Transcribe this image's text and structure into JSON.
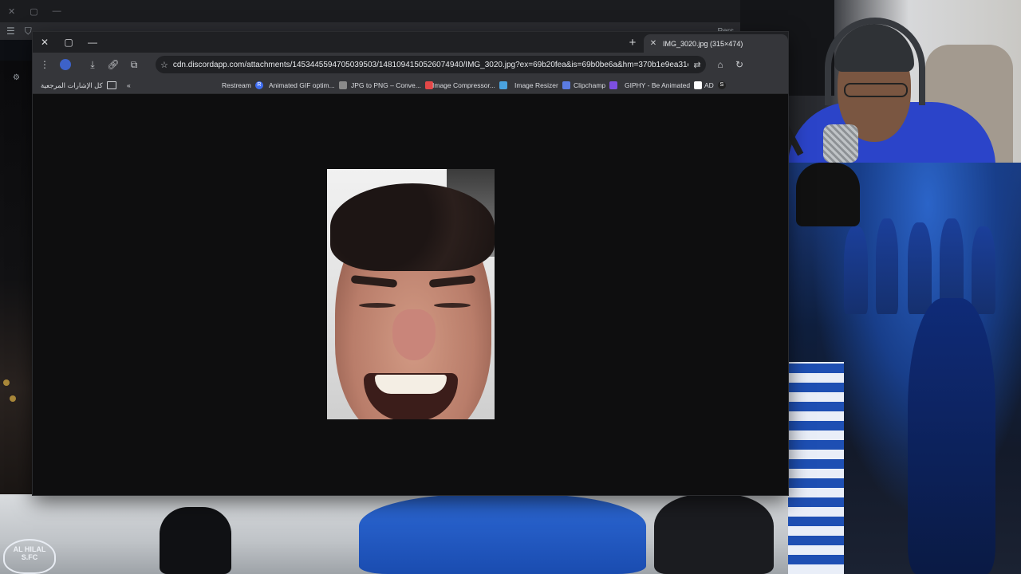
{
  "background": {
    "top_bar_title": "Pers",
    "club_badge_text": "AL HILAL S.FC"
  },
  "browser": {
    "tab": {
      "title": "IMG_3020.jpg (315×474)"
    },
    "omnibox": {
      "url": "cdn.discordapp.com/attachments/1453445594705039503/1481094150526074940/IMG_3020.jpg?ex=69b20fea&is=69b0be6a&hm=370b1e9ea31c7717e..."
    },
    "bookmarks": {
      "all_bookmarks_label": "كل الإشارات المرجعية",
      "items": [
        {
          "label": "Restream",
          "favicon_color": "#3f6ef2",
          "favicon_text": "R"
        },
        {
          "label": "Animated GIF optim...",
          "favicon_color": "#8a8a8a",
          "favicon_text": ""
        },
        {
          "label": "JPG to PNG – Conve...",
          "favicon_color": "#e34848",
          "favicon_text": ""
        },
        {
          "label": "Image Compressor...",
          "favicon_color": "#4aa3df",
          "favicon_text": ""
        },
        {
          "label": "Image Resizer",
          "favicon_color": "#5b7ce2",
          "favicon_text": ""
        },
        {
          "label": "Clipchamp",
          "favicon_color": "#7d4fe0",
          "favicon_text": ""
        },
        {
          "label": "GIPHY - Be Animated",
          "favicon_color": "#ffffff",
          "favicon_text": ""
        },
        {
          "label": "AD",
          "favicon_color": "#222222",
          "favicon_text": "S"
        }
      ]
    }
  },
  "colors": {
    "chrome_dark": "#35363a",
    "titlebar": "#1f2023",
    "viewport": "#0e0e0f",
    "accent_blue": "#2b44c9"
  }
}
